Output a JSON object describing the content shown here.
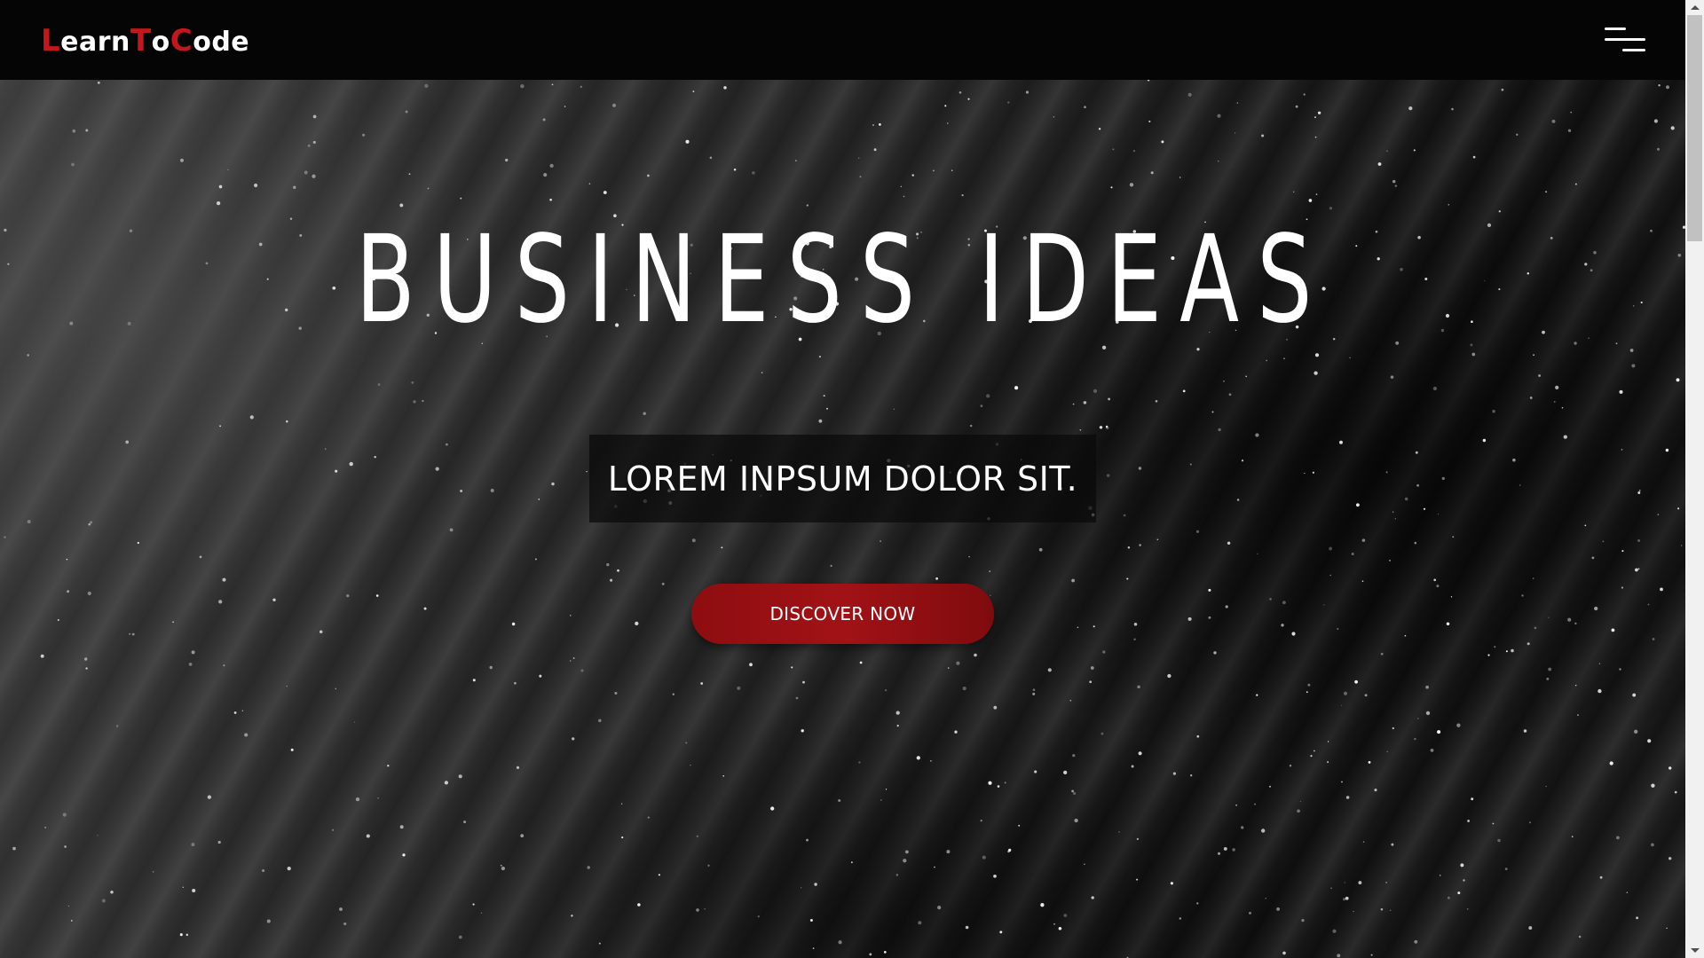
{
  "header": {
    "logo": {
      "parts": [
        {
          "text": "L",
          "accent": true
        },
        {
          "text": "earn",
          "accent": false
        },
        {
          "text": "T",
          "accent": true
        },
        {
          "text": "o",
          "accent": false
        },
        {
          "text": "C",
          "accent": true
        },
        {
          "text": "ode",
          "accent": false
        }
      ]
    },
    "menu_icon": "hamburger-menu-icon"
  },
  "hero": {
    "title": "BUSINESS IDEAS",
    "subtitle": "LOREM INPSUM DOLOR SIT.",
    "cta_label": "DISCOVER NOW"
  },
  "colors": {
    "accent": "#c2181d",
    "button": "#a11216",
    "navbar": "#050505",
    "text": "#ffffff"
  }
}
